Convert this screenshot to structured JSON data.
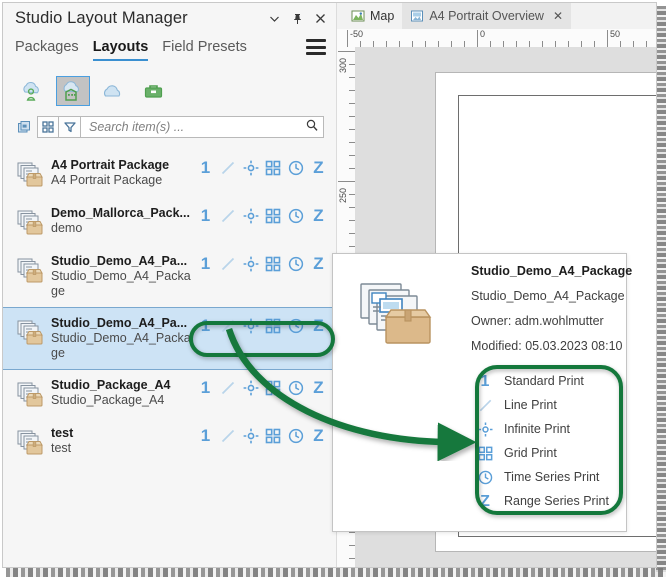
{
  "panel": {
    "title": "Studio Layout Manager",
    "title_buttons": [
      {
        "name": "chevron-down-icon",
        "label": "v"
      },
      {
        "name": "pin-icon",
        "label": "pin"
      },
      {
        "name": "close-icon",
        "label": "x"
      }
    ],
    "tabs": [
      {
        "label": "Packages",
        "active": false
      },
      {
        "label": "Layouts",
        "active": true
      },
      {
        "label": "Field Presets",
        "active": false
      }
    ],
    "menu_icon": "hamburger-menu-icon",
    "sources": [
      {
        "name": "my-content-cloud-icon",
        "selected": false
      },
      {
        "name": "organization-cloud-icon",
        "selected": true
      },
      {
        "name": "all-cloud-icon",
        "selected": false
      },
      {
        "name": "portfolio-briefcase-icon",
        "selected": false
      }
    ],
    "search": {
      "copy_icon": "copy-icon",
      "grid_icon": "grid-view-icon",
      "filter_icon": "filter-funnel-icon",
      "placeholder": "Search item(s) ...",
      "value": "",
      "magnifier_icon": "search-icon"
    }
  },
  "print_types": [
    {
      "key": "standard",
      "glyph": "1",
      "icon": "standard-print-icon",
      "label": "Standard Print"
    },
    {
      "key": "line",
      "glyph": "/",
      "icon": "line-print-icon",
      "label": "Line Print"
    },
    {
      "key": "infinite",
      "glyph": "o",
      "icon": "infinite-print-icon",
      "label": "Infinite Print"
    },
    {
      "key": "grid",
      "glyph": "::",
      "icon": "grid-print-icon",
      "label": "Grid Print"
    },
    {
      "key": "time",
      "glyph": "clock",
      "icon": "time-series-print-icon",
      "label": "Time Series Print"
    },
    {
      "key": "range",
      "glyph": "Z",
      "icon": "range-series-print-icon",
      "label": "Range Series Print"
    }
  ],
  "list": {
    "rows": [
      {
        "title": "A4 Portrait Package",
        "subtitle": "A4 Portrait Package",
        "selected": false
      },
      {
        "title": "Demo_Mallorca_Pack...",
        "subtitle": "demo",
        "selected": false
      },
      {
        "title": "Studio_Demo_A4_Pa...",
        "subtitle": "Studio_Demo_A4_Package",
        "selected": false
      },
      {
        "title": "Studio_Demo_A4_Pa...",
        "subtitle": "Studio_Demo_A4_Package",
        "selected": true
      },
      {
        "title": "Studio_Package_A4",
        "subtitle": "Studio_Package_A4",
        "selected": false
      },
      {
        "title": "test",
        "subtitle": "test",
        "selected": false
      }
    ]
  },
  "editor": {
    "tabs": [
      {
        "label": "Map",
        "icon": "map-icon",
        "active": false,
        "closable": false
      },
      {
        "label": "A4 Portrait Overview",
        "icon": "layout-icon",
        "active": true,
        "closable": true,
        "close_label": "✕"
      }
    ],
    "ruler_h": {
      "labels": [
        "-50",
        "0",
        "50"
      ]
    },
    "ruler_v": {
      "labels": [
        "300",
        "250"
      ]
    }
  },
  "popup": {
    "icon": "package-stack-icon",
    "title": "Studio_Demo_A4_Package",
    "name": "Studio_Demo_A4_Package",
    "owner": "Owner: adm.wohlmutter",
    "modified": "Modified: 05.03.2023 08:10"
  },
  "annotations": {
    "color": "#14783c",
    "shapes": [
      "row-glyphs-ellipse",
      "legend-ellipse",
      "curved-arrow"
    ]
  },
  "colors": {
    "accent_blue": "#5b9fd8",
    "selection_blue": "#cde3f5",
    "annotation_green": "#14783c",
    "panel_bg": "#f6f6f6",
    "canvas_bg": "#dedede"
  }
}
